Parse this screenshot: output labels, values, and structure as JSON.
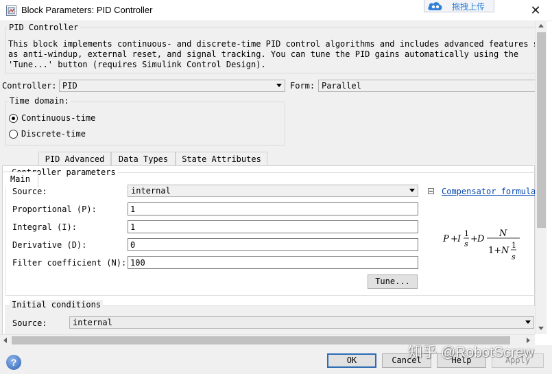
{
  "window": {
    "title": "Block Parameters: PID Controller",
    "close_glyph": "✕"
  },
  "overlay": {
    "cloud_label": "拖拽上传",
    "watermark": "知乎 @RobotScrew"
  },
  "block": {
    "group_title": "PID Controller",
    "description": "This block implements continuous- and discrete-time PID control algorithms and includes advanced features such\nas anti-windup, external reset, and signal tracking. You can tune the PID gains automatically using the\n'Tune...' button (requires Simulink Control Design)."
  },
  "controller": {
    "label": "Controller:",
    "value": "PID",
    "form_label": "Form:",
    "form_value": "Parallel"
  },
  "time_domain": {
    "title": "Time domain:",
    "options": [
      {
        "label": "Continuous-time",
        "selected": true
      },
      {
        "label": "Discrete-time",
        "selected": false
      }
    ]
  },
  "tabs": [
    {
      "label": "Main",
      "active": true
    },
    {
      "label": "PID Advanced",
      "active": false
    },
    {
      "label": "Data Types",
      "active": false
    },
    {
      "label": "State Attributes",
      "active": false
    }
  ],
  "controller_params": {
    "title": "Controller parameters",
    "source_label": "Source:",
    "source_value": "internal",
    "compensator_link": "Compensator formula",
    "fields": [
      {
        "label": "Proportional (P):",
        "value": "1"
      },
      {
        "label": "Integral (I):",
        "value": "1"
      },
      {
        "label": "Derivative (D):",
        "value": "0"
      },
      {
        "label": "Filter coefficient (N):",
        "value": "100"
      }
    ],
    "tune_button": "Tune..."
  },
  "formula": {
    "P": "P",
    "plus1": "+",
    "I": "I",
    "one_a": "1",
    "s_a": "s",
    "plus2": "+",
    "D": "D",
    "N_num": "N",
    "one_plus": "1+",
    "N_den": "N",
    "one_b": "1",
    "s_b": "s"
  },
  "initial_conditions": {
    "title": "Initial conditions",
    "source_label": "Source:",
    "source_value": "internal"
  },
  "buttons": {
    "ok": "OK",
    "cancel": "Cancel",
    "help": "Help",
    "apply": "Apply"
  },
  "icons": {
    "app": "block-parameters-icon",
    "help": "help-icon",
    "cloud": "cloud-upload-icon"
  },
  "colors": {
    "dialog_bg": "#f0f0f0",
    "tab_panel_bg": "#ffffff",
    "link": "#0645ad",
    "default_button_border": "#2d6bb3",
    "cloud_text": "#2f80d6"
  }
}
